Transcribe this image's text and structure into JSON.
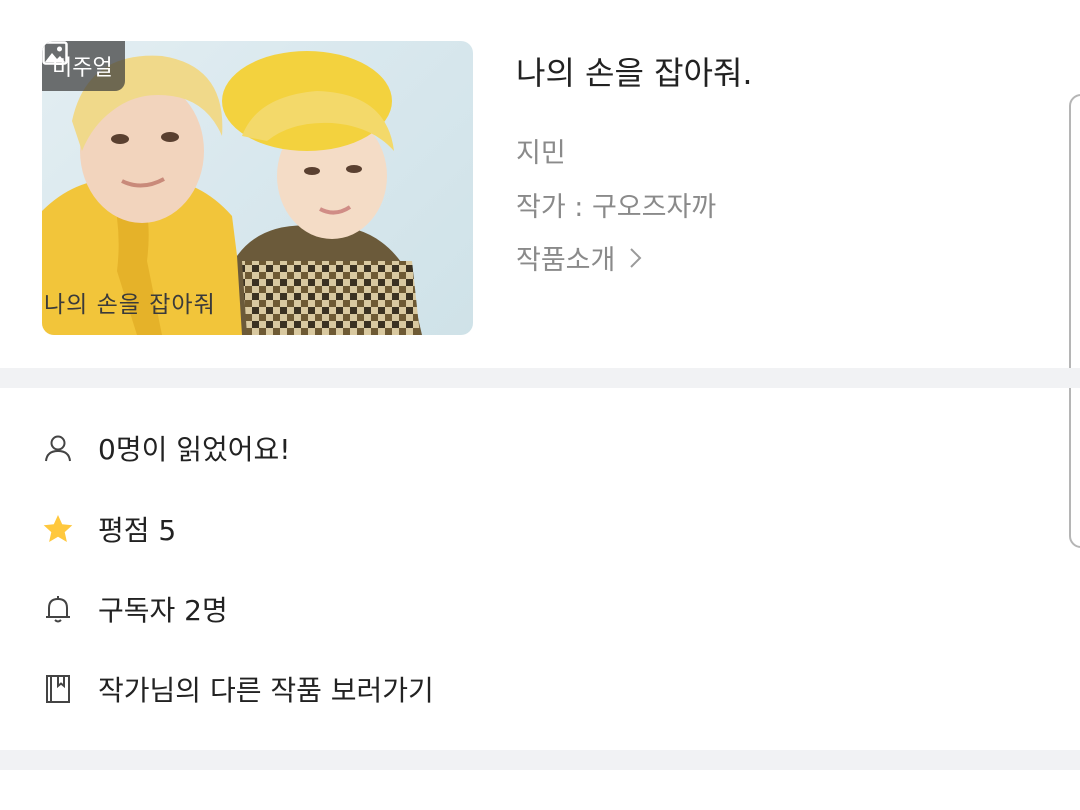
{
  "cover": {
    "badge_label": "비주얼",
    "badge_icon": "image-icon",
    "caption": "나의 손을 잡아줘"
  },
  "work": {
    "title": "나의 손을 잡아줘.",
    "genre": "지민",
    "author": "작가 : 구오즈자까",
    "intro_label": "작품소개",
    "intro_icon": "chevron-right-icon"
  },
  "stats": {
    "readers": {
      "icon": "person-icon",
      "label": "0명이 읽었어요!"
    },
    "rating": {
      "icon": "star-icon",
      "label": "평점 5",
      "color": "#FFC83D"
    },
    "subscribers": {
      "icon": "bell-icon",
      "label": "구독자 2명"
    },
    "other_works": {
      "icon": "book-icon",
      "label": "작가님의 다른 작품 보러가기"
    }
  }
}
